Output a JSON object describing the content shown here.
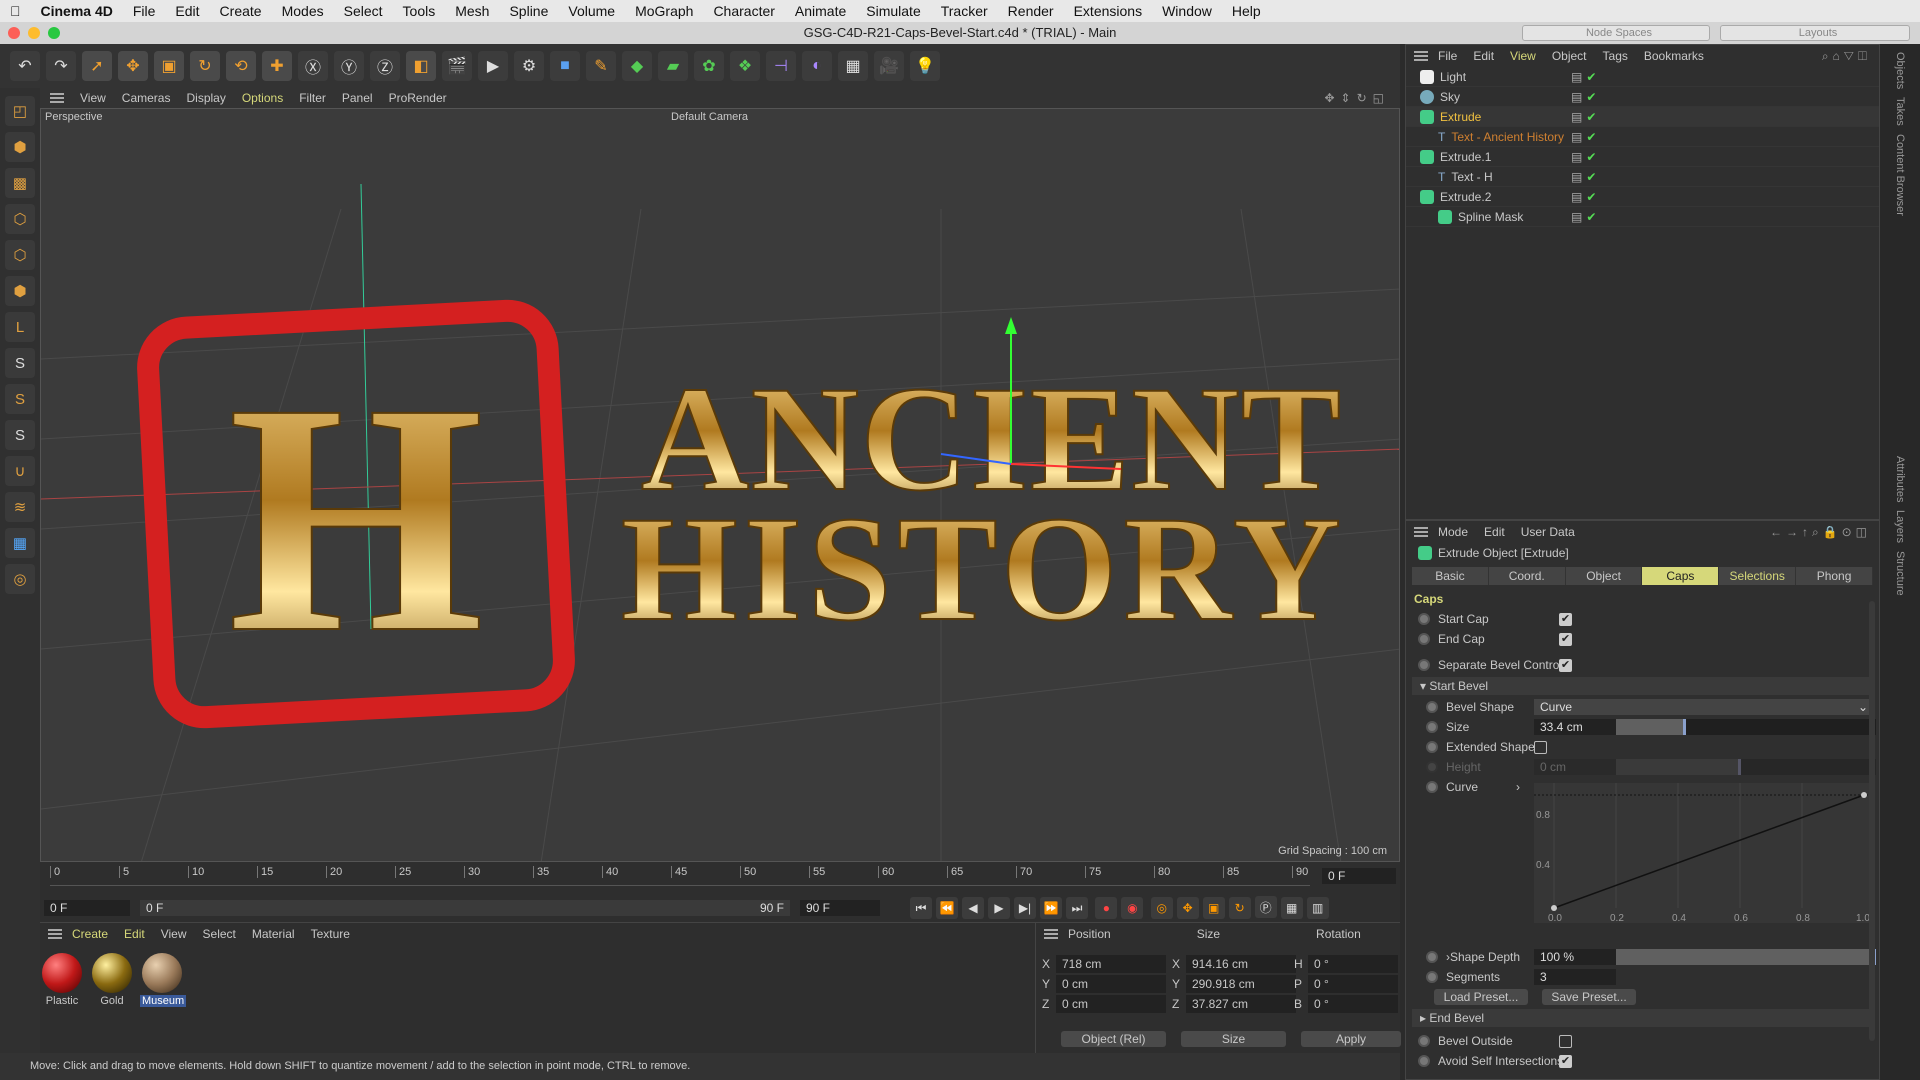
{
  "menubar": {
    "app": "Cinema 4D",
    "items": [
      "File",
      "Edit",
      "Create",
      "Modes",
      "Select",
      "Tools",
      "Mesh",
      "Spline",
      "Volume",
      "MoGraph",
      "Character",
      "Animate",
      "Simulate",
      "Tracker",
      "Render",
      "Extensions",
      "Window",
      "Help"
    ]
  },
  "title": "GSG-C4D-R21-Caps-Bevel-Start.c4d * (TRIAL) - Main",
  "topright": {
    "node_spaces": "Node Spaces",
    "layouts": "Layouts"
  },
  "viewport": {
    "menu": [
      "View",
      "Cameras",
      "Display",
      "Options",
      "Filter",
      "Panel",
      "ProRender"
    ],
    "label": "Perspective",
    "camera": "Default Camera",
    "grid_spacing": "Grid Spacing : 100 cm",
    "scene_text_1": "ANCIENT",
    "scene_text_2": "HISTORY",
    "scene_logo": "H"
  },
  "timeline": {
    "ticks": [
      "0",
      "5",
      "10",
      "15",
      "20",
      "25",
      "30",
      "35",
      "40",
      "45",
      "50",
      "55",
      "60",
      "65",
      "70",
      "75",
      "80",
      "85",
      "90"
    ],
    "current_frame": "0 F",
    "start": "0 F",
    "range_start": "0 F",
    "range_end": "90 F",
    "end": "90 F"
  },
  "materials": {
    "menu": [
      "Create",
      "Edit",
      "View",
      "Select",
      "Material",
      "Texture"
    ],
    "items": [
      {
        "name": "Plastic",
        "color": "#c01818"
      },
      {
        "name": "Gold",
        "color": "#8a6a10"
      },
      {
        "name": "Museum",
        "color": "#9a7a5a"
      }
    ]
  },
  "coords": {
    "headers": [
      "Position",
      "Size",
      "Rotation"
    ],
    "rows": [
      {
        "axis": "X",
        "pos": "718 cm",
        "saxis": "X",
        "size": "914.16 cm",
        "raxis": "H",
        "rot": "0 °"
      },
      {
        "axis": "Y",
        "pos": "0 cm",
        "saxis": "Y",
        "size": "290.918 cm",
        "raxis": "P",
        "rot": "0 °"
      },
      {
        "axis": "Z",
        "pos": "0 cm",
        "saxis": "Z",
        "size": "37.827 cm",
        "raxis": "B",
        "rot": "0 °"
      }
    ],
    "mode": "Object (Rel)",
    "size_mode": "Size",
    "apply": "Apply"
  },
  "status": "Move: Click and drag to move elements. Hold down SHIFT to quantize movement / add to the selection in point mode, CTRL to remove.",
  "objects": {
    "menu": [
      "File",
      "Edit",
      "View",
      "Object",
      "Tags",
      "Bookmarks"
    ],
    "items": [
      {
        "name": "Light",
        "indent": 0
      },
      {
        "name": "Sky",
        "indent": 0
      },
      {
        "name": "Extrude",
        "indent": 0,
        "selected": true
      },
      {
        "name": "Text - Ancient History",
        "indent": 1
      },
      {
        "name": "Extrude.1",
        "indent": 0
      },
      {
        "name": "Text - H",
        "indent": 1
      },
      {
        "name": "Extrude.2",
        "indent": 0
      },
      {
        "name": "Spline Mask",
        "indent": 1
      }
    ]
  },
  "attributes": {
    "menu": [
      "Mode",
      "Edit",
      "User Data"
    ],
    "object_title": "Extrude Object [Extrude]",
    "tabs": [
      "Basic",
      "Coord.",
      "Object",
      "Caps",
      "Selections",
      "Phong"
    ],
    "active_tab": "Caps",
    "section": "Caps",
    "start_cap": "Start Cap",
    "end_cap": "End Cap",
    "separate": "Separate Bevel Controls",
    "start_bevel": "Start Bevel",
    "bevel_shape_label": "Bevel Shape",
    "bevel_shape": "Curve",
    "size_label": "Size",
    "size": "33.4 cm",
    "size_fraction": 0.27,
    "extended_label": "Extended Shape",
    "height_label": "Height",
    "height": "0 cm",
    "curve_label": "Curve",
    "curve_ticks_x": [
      "0.0",
      "0.2",
      "0.4",
      "0.6",
      "0.8",
      "1.0"
    ],
    "curve_ticks_y": [
      "0.8",
      "0.4"
    ],
    "shape_depth_label": "Shape Depth",
    "shape_depth": "100 %",
    "shape_depth_fraction": 1.0,
    "segments_label": "Segments",
    "segments": "3",
    "load_preset": "Load Preset...",
    "save_preset": "Save Preset...",
    "end_bevel": "End Bevel",
    "bevel_outside": "Bevel Outside",
    "avoid": "Avoid Self Intersections"
  },
  "side_tabs": [
    "Objects",
    "Takes",
    "Content Browser",
    "Attributes",
    "Layers",
    "Structure"
  ],
  "colors": {
    "accent": "#d6d87a",
    "gold": "#c8962a",
    "red": "#d42020"
  }
}
